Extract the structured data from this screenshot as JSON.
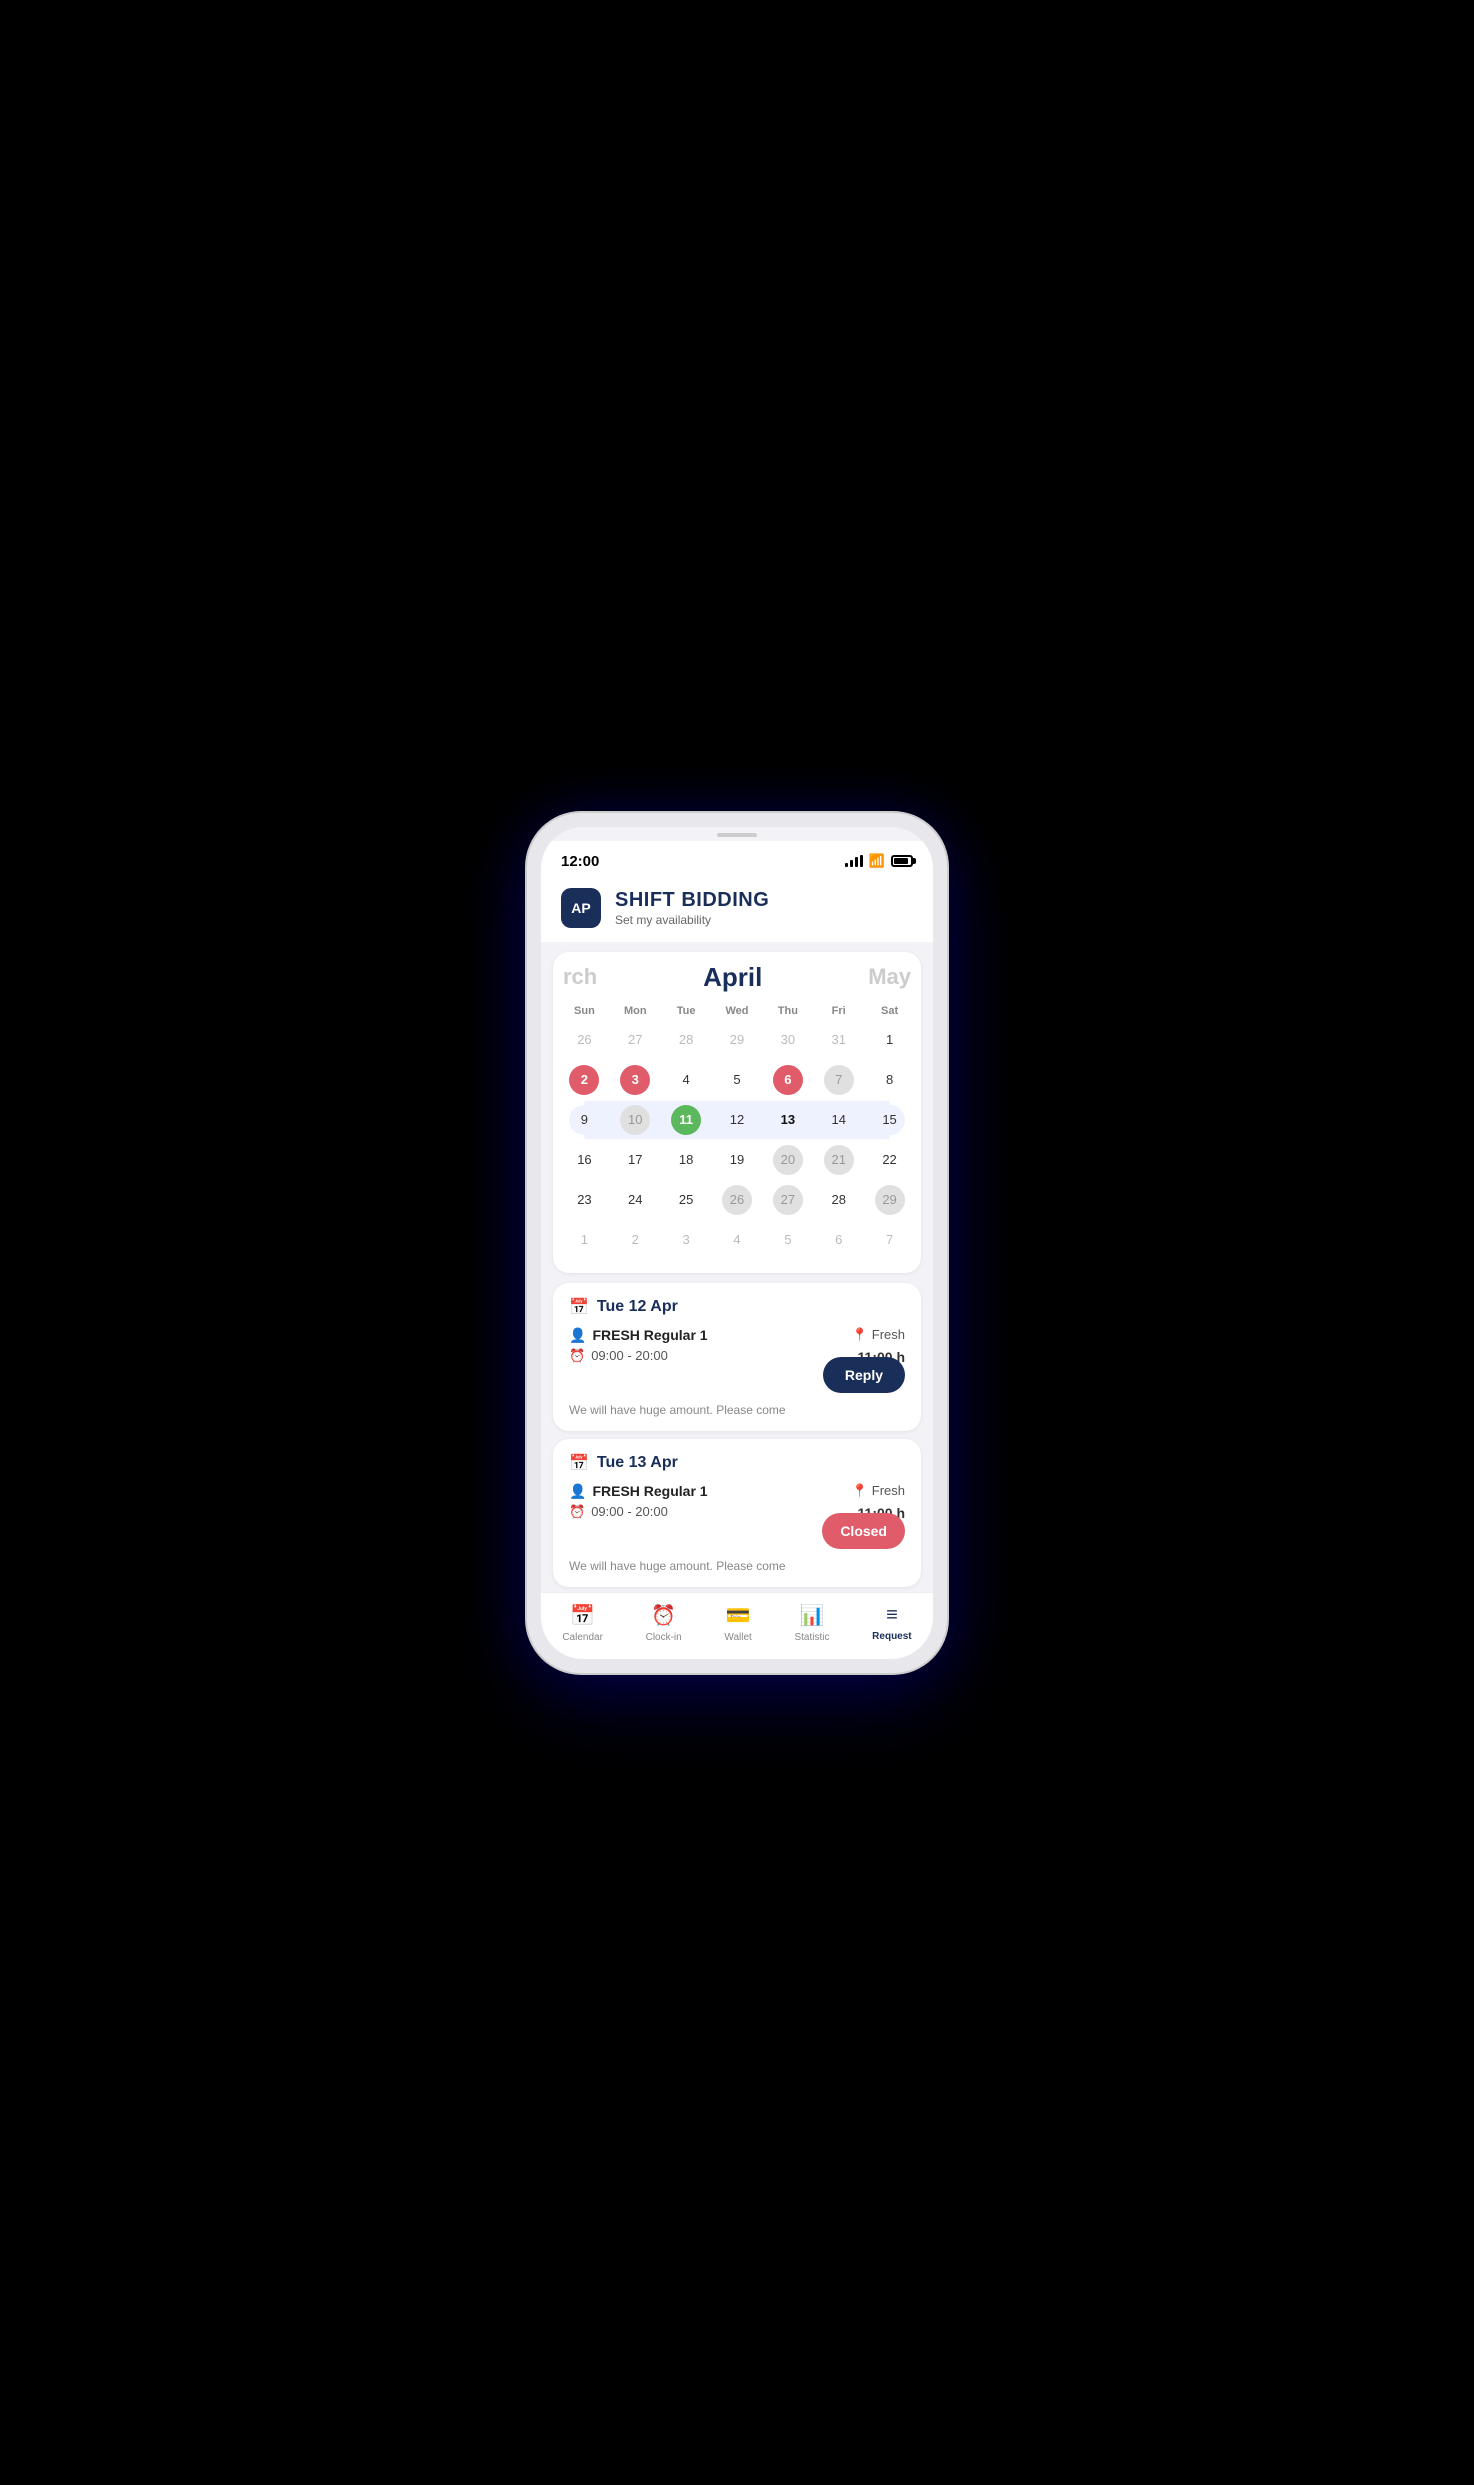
{
  "phone": {
    "time": "12:00"
  },
  "header": {
    "avatar": "AP",
    "title": "SHIFT BIDDING",
    "subtitle": "Set my availability"
  },
  "calendar": {
    "prev_month": "rch",
    "current_month": "April",
    "next_month": "May",
    "day_labels": [
      "Sun",
      "Mon",
      "Tue",
      "Wed",
      "Thu",
      "Fri",
      "Sat"
    ],
    "weeks": [
      [
        {
          "num": "26",
          "type": "other"
        },
        {
          "num": "27",
          "type": "other"
        },
        {
          "num": "28",
          "type": "other"
        },
        {
          "num": "29",
          "type": "other"
        },
        {
          "num": "30",
          "type": "other"
        },
        {
          "num": "31",
          "type": "other"
        },
        {
          "num": "1",
          "type": "normal"
        }
      ],
      [
        {
          "num": "2",
          "type": "red"
        },
        {
          "num": "3",
          "type": "red"
        },
        {
          "num": "4",
          "type": "normal"
        },
        {
          "num": "5",
          "type": "normal"
        },
        {
          "num": "6",
          "type": "red"
        },
        {
          "num": "7",
          "type": "gray"
        },
        {
          "num": "8",
          "type": "normal"
        }
      ],
      [
        {
          "num": "9",
          "type": "normal",
          "hl": true
        },
        {
          "num": "10",
          "type": "gray",
          "hl": true
        },
        {
          "num": "11",
          "type": "green",
          "hl": true
        },
        {
          "num": "12",
          "type": "normal",
          "hl": true
        },
        {
          "num": "13",
          "type": "bold",
          "hl": true
        },
        {
          "num": "14",
          "type": "normal",
          "hl": true
        },
        {
          "num": "15",
          "type": "normal",
          "hl": true
        }
      ],
      [
        {
          "num": "16",
          "type": "normal"
        },
        {
          "num": "17",
          "type": "normal"
        },
        {
          "num": "18",
          "type": "normal"
        },
        {
          "num": "19",
          "type": "normal"
        },
        {
          "num": "20",
          "type": "gray"
        },
        {
          "num": "21",
          "type": "gray"
        },
        {
          "num": "22",
          "type": "normal"
        }
      ],
      [
        {
          "num": "23",
          "type": "normal"
        },
        {
          "num": "24",
          "type": "normal"
        },
        {
          "num": "25",
          "type": "normal"
        },
        {
          "num": "26",
          "type": "gray"
        },
        {
          "num": "27",
          "type": "gray"
        },
        {
          "num": "28",
          "type": "normal"
        },
        {
          "num": "29",
          "type": "gray"
        }
      ],
      [
        {
          "num": "1",
          "type": "other"
        },
        {
          "num": "2",
          "type": "other"
        },
        {
          "num": "3",
          "type": "other"
        },
        {
          "num": "4",
          "type": "other"
        },
        {
          "num": "5",
          "type": "other"
        },
        {
          "num": "6",
          "type": "other"
        },
        {
          "num": "7",
          "type": "other"
        }
      ]
    ]
  },
  "shifts": [
    {
      "date": "Tue 12 Apr",
      "role": "FRESH Regular 1",
      "location": "Fresh",
      "time": "09:00 - 20:00",
      "hours": "11:00 h",
      "note": "We will have huge amount. Please come",
      "action": "reply",
      "action_label": "Reply"
    },
    {
      "date": "Tue 13 Apr",
      "role": "FRESH Regular 1",
      "location": "Fresh",
      "time": "09:00 - 20:00",
      "hours": "11:00 h",
      "note": "We will have huge amount. Please come",
      "action": "closed",
      "action_label": "Closed"
    }
  ],
  "bottom_nav": [
    {
      "label": "Calendar",
      "icon": "📅",
      "active": false
    },
    {
      "label": "Clock-in",
      "icon": "⏰",
      "active": false
    },
    {
      "label": "Wallet",
      "icon": "👛",
      "active": false
    },
    {
      "label": "Statistic",
      "icon": "📊",
      "active": false
    },
    {
      "label": "Request",
      "icon": "≡",
      "active": true
    }
  ]
}
